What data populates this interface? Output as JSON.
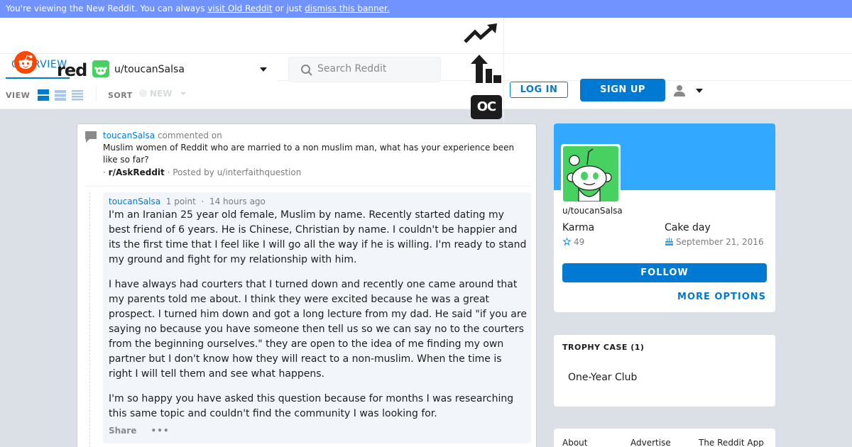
{
  "banner": {
    "prefix": "You're viewing the New Reddit. You can always ",
    "link1": "visit Old Reddit",
    "middle": " or just ",
    "link2": "dismiss this banner."
  },
  "header": {
    "logo_text": "reddit",
    "tab_overview": "OVERVIEW",
    "user_dropdown": "u/toucanSalsa",
    "search_placeholder": "Search Reddit",
    "oc_badge": "OC",
    "login": "LOG IN",
    "signup": "SIGN UP"
  },
  "toolbar": {
    "view_label": "VIEW",
    "sort_label": "SORT",
    "sort_value": "NEW"
  },
  "post": {
    "commenter": "toucanSalsa",
    "commented_on": "commented on",
    "title": "Muslim women of Reddit who are married to a non muslim man, what has your experience been like so far?",
    "bullet": "·",
    "subreddit": "r/AskReddit",
    "posted_by": "· Posted by u/interfaithquestion"
  },
  "comment": {
    "author": "toucanSalsa",
    "points": "1 point",
    "dot": "·",
    "time": "14 hours ago",
    "paragraphs": [
      "I'm an Iranian 25 year old female, Muslim by name. Recently started dating my best friend of 6 years. He is Chinese, Christian by name. I couldn't be happier and its the first time that I feel like I will go all the way if he is willing. I'm ready to stand my ground and fight for my relationship with him.",
      "I have always had courters that I turned down and recently one came around that my parents told me about. I think they were excited because he was a great prospect. I turned him down and got a long lecture from my dad. He said \"if you are saying no because you have someone then tell us so we can say no to the courters from the beginning ourselves.\" they are open to the idea of me finding my own partner but I don't know how they will react to a non-muslim. When the time is right I will tell them and see what happens.",
      "I'm so happy you have asked this question because for months I was researching this same topic and couldn't find the community I was looking for."
    ],
    "share": "Share",
    "more": "•••"
  },
  "profile": {
    "username": "u/toucanSalsa",
    "karma_label": "Karma",
    "karma_value": "49",
    "cake_label": "Cake day",
    "cake_value": "September 21, 2016",
    "follow": "FOLLOW",
    "more_options": "MORE OPTIONS"
  },
  "trophy": {
    "title": "TROPHY CASE (1)",
    "item": "One-Year Club"
  },
  "footer": {
    "about": "About",
    "advertise": "Advertise",
    "app": "The Reddit App"
  },
  "colors": {
    "accent": "#0079d3",
    "banner": "#7193ff",
    "profile_banner": "#33a8ff",
    "avatar_green": "#46d160",
    "reddit_orange": "#ff4500"
  }
}
